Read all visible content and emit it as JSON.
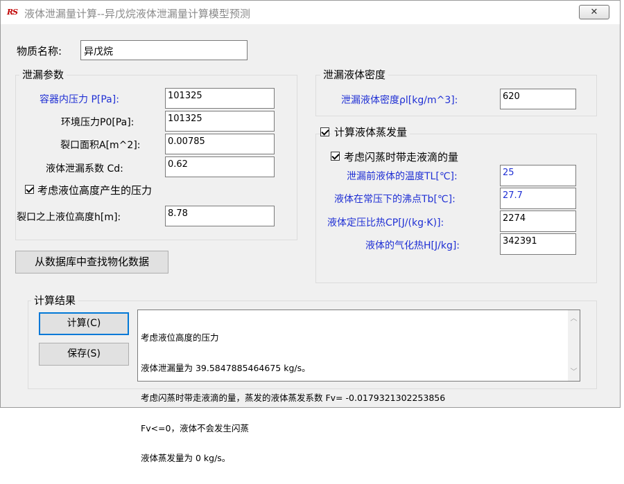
{
  "window": {
    "app_icon_text": "RS",
    "title": "液体泄漏量计算--异戊烷液体泄漏量计算模型预测",
    "close_glyph": "✕"
  },
  "substance": {
    "label": "物质名称:",
    "value": "异戊烷"
  },
  "leak_params": {
    "group_title": "泄漏参数",
    "container_pressure": {
      "label": "容器内压力 P[Pa]:",
      "value": "101325"
    },
    "ambient_pressure": {
      "label": "环境压力P0[Pa]:",
      "value": "101325"
    },
    "orifice_area": {
      "label": "裂口面积A[m^2]:",
      "value": "0.00785"
    },
    "discharge_coef": {
      "label": "液体泄漏系数  Cd:",
      "value": "0.62"
    },
    "consider_height": {
      "label": "考虑液位高度产生的压力",
      "checked": true
    },
    "liquid_height": {
      "label": "裂口之上液位高度h[m]:",
      "value": "8.78"
    }
  },
  "density": {
    "group_title": "泄漏液体密度",
    "label": "泄漏液体密度ρl[kg/m^3]:",
    "value": "620"
  },
  "evaporation": {
    "group_title": "计算液体蒸发量",
    "checked": true,
    "flash": {
      "label": "考虑闪蒸时带走液滴的量",
      "checked": true
    },
    "temp_before": {
      "label": "泄漏前液体的温度TL[℃]:",
      "value": "25"
    },
    "boiling_point": {
      "label": "液体在常压下的沸点Tb[℃]:",
      "value": "27.7"
    },
    "specific_heat": {
      "label": "液体定压比热CP[J/(kg·K)]:",
      "value": "2274"
    },
    "vaporization_heat": {
      "label": "液体的气化热H[J/kg]:",
      "value": "342391"
    }
  },
  "db_button": "从数据库中查找物化数据",
  "results": {
    "group_title": "计算结果",
    "calc_button": "计算(C)",
    "save_button": "保存(S)",
    "lines": [
      "考虑液位高度的压力",
      "液体泄漏量为 39.5847885464675 kg/s。",
      "考虑闪蒸时带走液滴的量，蒸发的液体蒸发系数 Fv= -0.0179321302253856",
      "Fv<=0，液体不会发生闪蒸",
      "液体蒸发量为 0 kg/s。"
    ]
  }
}
